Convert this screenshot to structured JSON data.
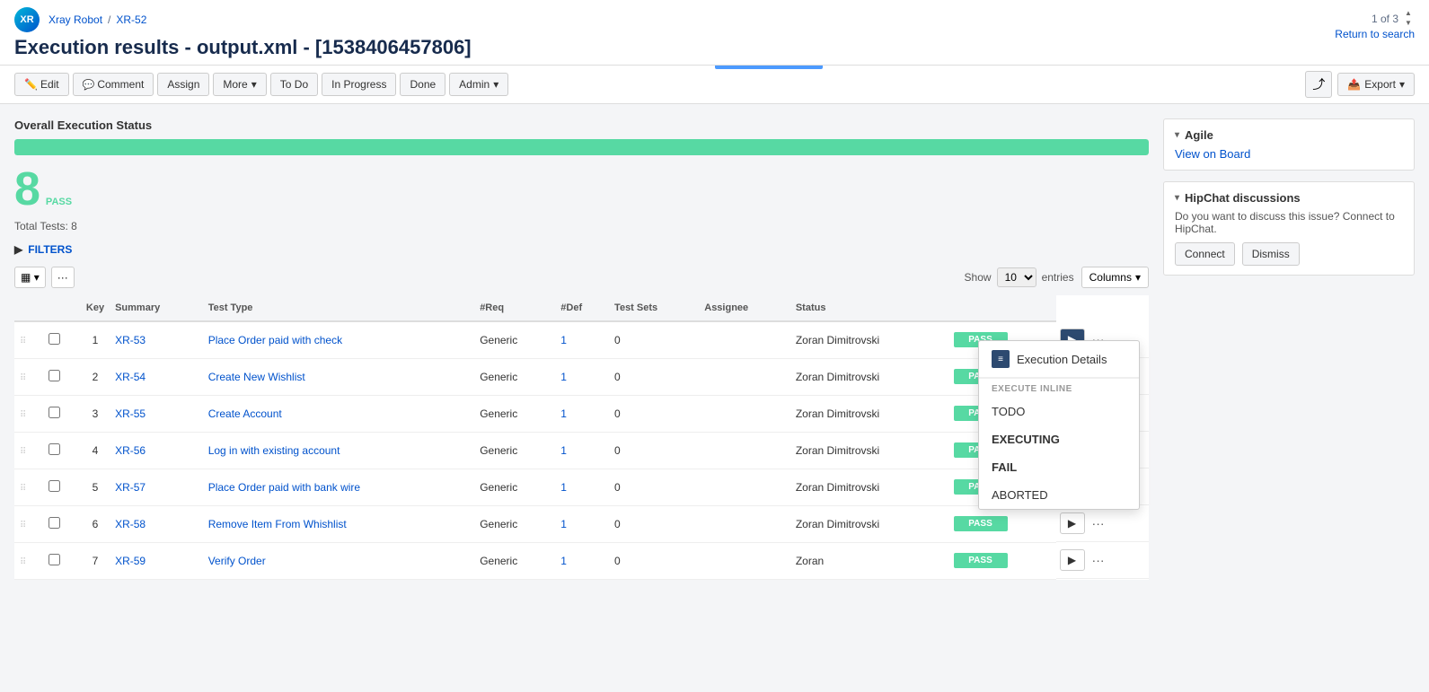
{
  "app": {
    "logo_text": "XR",
    "breadcrumb": {
      "parent": "Xray Robot",
      "separator": "/",
      "current": "XR-52"
    },
    "title": "Execution results - output.xml - [1538406457806]",
    "nav": {
      "counter": "1 of 3",
      "return_label": "Return to search"
    }
  },
  "toolbar": {
    "edit_label": "Edit",
    "comment_label": "Comment",
    "assign_label": "Assign",
    "more_label": "More",
    "todo_label": "To Do",
    "in_progress_label": "In Progress",
    "done_label": "Done",
    "admin_label": "Admin",
    "export_label": "Export",
    "share_icon": "⤴"
  },
  "main": {
    "overall_status_title": "Overall Execution Status",
    "progress_percent": 100,
    "pass_count": 8,
    "pass_label": "PASS",
    "total_tests_label": "Total Tests: 8",
    "filters_label": "FILTERS",
    "show_label": "Show",
    "show_value": "10",
    "entries_label": "entries",
    "columns_label": "Columns",
    "table": {
      "headers": [
        "",
        "",
        "Key",
        "Summary",
        "Test Type",
        "#Req",
        "#Def",
        "Test Sets",
        "Assignee",
        "Status",
        ""
      ],
      "rows": [
        {
          "num": 1,
          "key": "XR-53",
          "summary": "Place Order paid with check",
          "test_type": "Generic",
          "req": 1,
          "def": 0,
          "test_sets": "",
          "assignee": "Zoran Dimitrovski",
          "status": "PASS"
        },
        {
          "num": 2,
          "key": "XR-54",
          "summary": "Create New Wishlist",
          "test_type": "Generic",
          "req": 1,
          "def": 0,
          "test_sets": "",
          "assignee": "Zoran Dimitrovski",
          "status": "PASS"
        },
        {
          "num": 3,
          "key": "XR-55",
          "summary": "Create Account",
          "test_type": "Generic",
          "req": 1,
          "def": 0,
          "test_sets": "",
          "assignee": "Zoran Dimitrovski",
          "status": "PASS"
        },
        {
          "num": 4,
          "key": "XR-56",
          "summary": "Log in with existing account",
          "test_type": "Generic",
          "req": 1,
          "def": 0,
          "test_sets": "",
          "assignee": "Zoran Dimitrovski",
          "status": "PASS"
        },
        {
          "num": 5,
          "key": "XR-57",
          "summary": "Place Order paid with bank wire",
          "test_type": "Generic",
          "req": 1,
          "def": 0,
          "test_sets": "",
          "assignee": "Zoran Dimitrovski",
          "status": "PASS"
        },
        {
          "num": 6,
          "key": "XR-58",
          "summary": "Remove Item From Whishlist",
          "test_type": "Generic",
          "req": 1,
          "def": 0,
          "test_sets": "",
          "assignee": "Zoran Dimitrovski",
          "status": "PASS"
        },
        {
          "num": 7,
          "key": "XR-59",
          "summary": "Verify Order",
          "test_type": "Generic",
          "req": 1,
          "def": 0,
          "test_sets": "",
          "assignee": "Zoran",
          "status": "PASS"
        }
      ]
    }
  },
  "dropdown_popup": {
    "exec_details_label": "Execution Details",
    "execute_inline_label": "EXECUTE INLINE",
    "todo_label": "TODO",
    "executing_label": "EXECUTING",
    "fail_label": "FAIL",
    "aborted_label": "ABORTED"
  },
  "sidebar": {
    "agile_label": "Agile",
    "view_on_board_label": "View on Board",
    "hipchat_label": "HipChat discussions",
    "hipchat_text": "Do you want to discuss this issue? Connect to HipChat.",
    "connect_label": "Connect",
    "dismiss_label": "Dismiss"
  },
  "colors": {
    "pass_green": "#57d9a3",
    "link_blue": "#0052cc",
    "action_dark": "#2d4a70",
    "executing_orange": "#f79232",
    "fail_red": "#de350b"
  }
}
